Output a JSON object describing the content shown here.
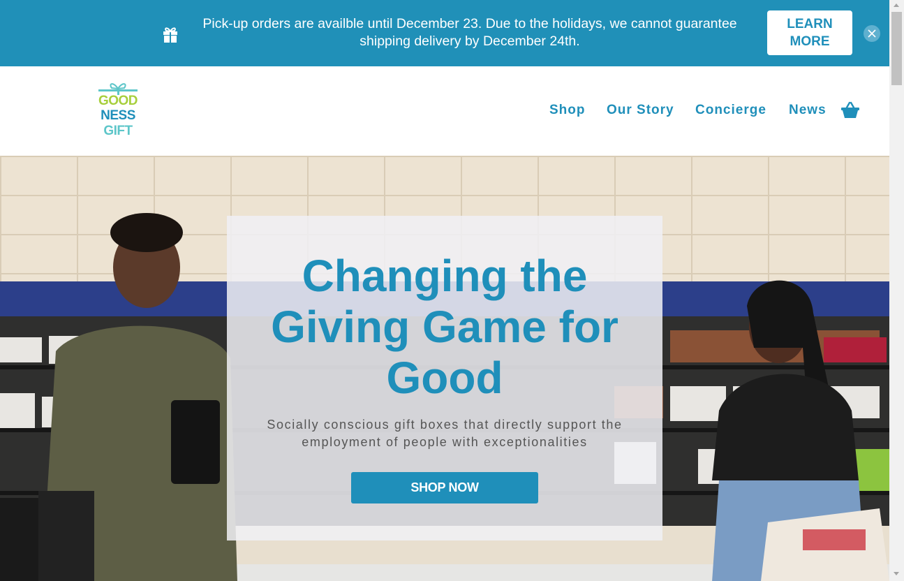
{
  "announcement": {
    "icon": "gift-icon",
    "text": "Pick-up orders are availble until December 23. Due to the holidays, we cannot guarantee shipping delivery by December 24th.",
    "button_label": "LEARN MORE",
    "close_icon": "close-icon"
  },
  "logo": {
    "line1": "GOOD",
    "line2": "NESS",
    "line3": "GIFT"
  },
  "nav": {
    "items": [
      {
        "label": "Shop"
      },
      {
        "label": "Our Story"
      },
      {
        "label": "Concierge"
      },
      {
        "label": "News"
      }
    ],
    "cart_icon": "basket-icon"
  },
  "hero": {
    "title": "Changing the Giving Game for Good",
    "subtitle": "Socially conscious gift boxes that directly support the employment of people with exceptionalities",
    "button_label": "SHOP NOW"
  },
  "colors": {
    "brand_blue": "#1f8fba",
    "banner_blue": "#2090b8",
    "logo_green": "#a7cf3c",
    "logo_teal": "#5dc6c9"
  }
}
